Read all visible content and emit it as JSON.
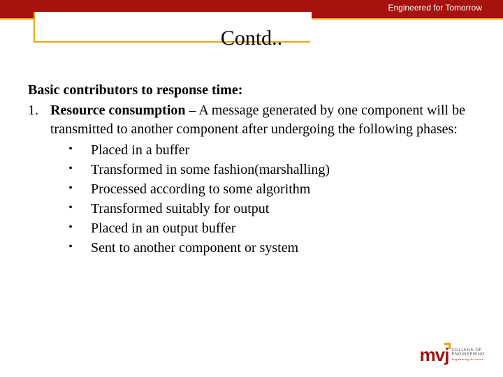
{
  "header": {
    "tagline": "Engineered for Tomorrow"
  },
  "title": "Contd..",
  "content": {
    "intro": "Basic contributors to response time:",
    "item": {
      "number": "1.",
      "lead": "Resource consumption",
      "tail": " – A message generated by one component will be transmitted to another component after undergoing the following phases:"
    },
    "bullets": [
      "Placed in a buffer",
      "Transformed in some fashion(marshalling)",
      "Processed according to some algorithm",
      "Transformed suitably for output",
      "Placed in an output buffer",
      "Sent to another component or system"
    ]
  },
  "footer": {
    "logo_mark": "mvj",
    "logo_line1": "COLLEGE OF",
    "logo_line2": "ENGINEERING",
    "logo_sub": "Engineering the future"
  }
}
